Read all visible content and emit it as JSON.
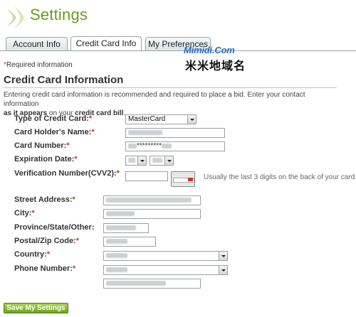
{
  "page": {
    "title": "Settings"
  },
  "tabs": [
    {
      "label": "Account Info",
      "active": false
    },
    {
      "label": "Credit Card Info",
      "active": true
    },
    {
      "label": "My Preferences",
      "active": false
    }
  ],
  "watermark": {
    "en": "Mimidi.Com",
    "cn": "米米地域名"
  },
  "required_note": {
    "star": "*",
    "text": "Required information"
  },
  "section": {
    "title": "Credit Card Information",
    "intro_part1": "Entering credit card information is recommended and required to place a bid. Enter your contact information",
    "intro_bold1": "as it appears",
    "intro_mid": " on your ",
    "intro_bold2": "credit card bill",
    "intro_end": "."
  },
  "form": {
    "card_type": {
      "label": "Type of Credit Card:",
      "star": "*",
      "value": "MasterCard"
    },
    "holder_name": {
      "label": "Card Holder's Name:",
      "star": "*"
    },
    "card_number": {
      "label": "Card Number:",
      "star": "*",
      "value": "*********"
    },
    "expiration": {
      "label": "Expiration Date:",
      "star": "*"
    },
    "cvv": {
      "label": "Verification Number(CVV2):",
      "star": "*",
      "hint": "Usually the last 3 digits on the back of your card."
    },
    "street": {
      "label": "Street Address:",
      "star": "*"
    },
    "city": {
      "label": "City:",
      "star": "*"
    },
    "province": {
      "label": "Province/State/Other:",
      "star": ""
    },
    "postal": {
      "label": "Postal/Zip Code:",
      "star": "*"
    },
    "country": {
      "label": "Country:",
      "star": "*"
    },
    "phone": {
      "label": "Phone Number:",
      "star": "*"
    }
  },
  "save_button": {
    "label": "Save My Settings"
  },
  "colors": {
    "brand_green": "#6a9a1f",
    "required_red": "#c0392b",
    "watermark_blue": "#2a6fc9"
  }
}
